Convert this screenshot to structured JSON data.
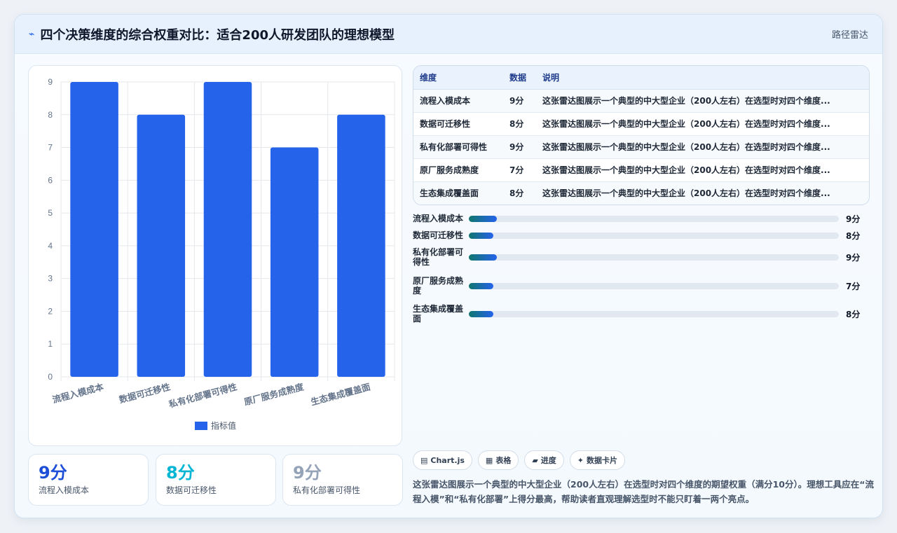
{
  "header": {
    "icon": "pulse-icon",
    "title": "四个决策维度的综合权重对比：适合200人研发团队的理想模型",
    "tag": "路径雷达"
  },
  "chart_data": {
    "type": "bar",
    "categories": [
      "流程入模成本",
      "数据可迁移性",
      "私有化部署可得性",
      "原厂服务成熟度",
      "生态集成覆盖面"
    ],
    "series": [
      {
        "name": "指标值",
        "values": [
          9,
          8,
          9,
          7,
          8
        ],
        "color": "#2563eb"
      }
    ],
    "ylim": [
      0,
      9
    ],
    "yticks": [
      0,
      1,
      2,
      3,
      4,
      5,
      6,
      7,
      8,
      9
    ],
    "legend": "bottom",
    "grid": true
  },
  "stats": [
    {
      "value": "9分",
      "label": "流程入模成本",
      "color": "#1d4ed8"
    },
    {
      "value": "8分",
      "label": "数据可迁移性",
      "color": "#06b6d4"
    },
    {
      "value": "9分",
      "label": "私有化部署可得性",
      "color": "#94a3b8"
    }
  ],
  "table": {
    "headers": [
      "维度",
      "数据",
      "说明"
    ],
    "rows": [
      {
        "dim": "流程入模成本",
        "val": "9分",
        "desc": "这张雷达图展示一个典型的中大型企业（200人左右）在选型时对四个维度..."
      },
      {
        "dim": "数据可迁移性",
        "val": "8分",
        "desc": "这张雷达图展示一个典型的中大型企业（200人左右）在选型时对四个维度..."
      },
      {
        "dim": "私有化部署可得性",
        "val": "9分",
        "desc": "这张雷达图展示一个典型的中大型企业（200人左右）在选型时对四个维度..."
      },
      {
        "dim": "原厂服务成熟度",
        "val": "7分",
        "desc": "这张雷达图展示一个典型的中大型企业（200人左右）在选型时对四个维度..."
      },
      {
        "dim": "生态集成覆盖面",
        "val": "8分",
        "desc": "这张雷达图展示一个典型的中大型企业（200人左右）在选型时对四个维度..."
      }
    ]
  },
  "progress": [
    {
      "label": "流程入模成本",
      "value": "9分",
      "fraction": 0.075
    },
    {
      "label": "数据可迁移性",
      "value": "8分",
      "fraction": 0.066
    },
    {
      "label": "私有化部署可得性",
      "value": "9分",
      "fraction": 0.075
    },
    {
      "label": "原厂服务成熟度",
      "value": "7分",
      "fraction": 0.066
    },
    {
      "label": "生态集成覆盖面",
      "value": "8分",
      "fraction": 0.066
    }
  ],
  "chips": [
    {
      "icon": "chart-icon",
      "glyph": "▤",
      "label": "Chart.js"
    },
    {
      "icon": "table-icon",
      "glyph": "▦",
      "label": "表格"
    },
    {
      "icon": "progress-icon",
      "glyph": "▰",
      "label": "进度"
    },
    {
      "icon": "card-icon",
      "glyph": "✦",
      "label": "数据卡片"
    }
  ],
  "description": "这张雷达图展示一个典型的中大型企业（200人左右）在选型时对四个维度的期望权重（满分10分）。理想工具应在“流程入模”和“私有化部署”上得分最高，帮助读者直观理解选型时不能只盯着一两个亮点。"
}
